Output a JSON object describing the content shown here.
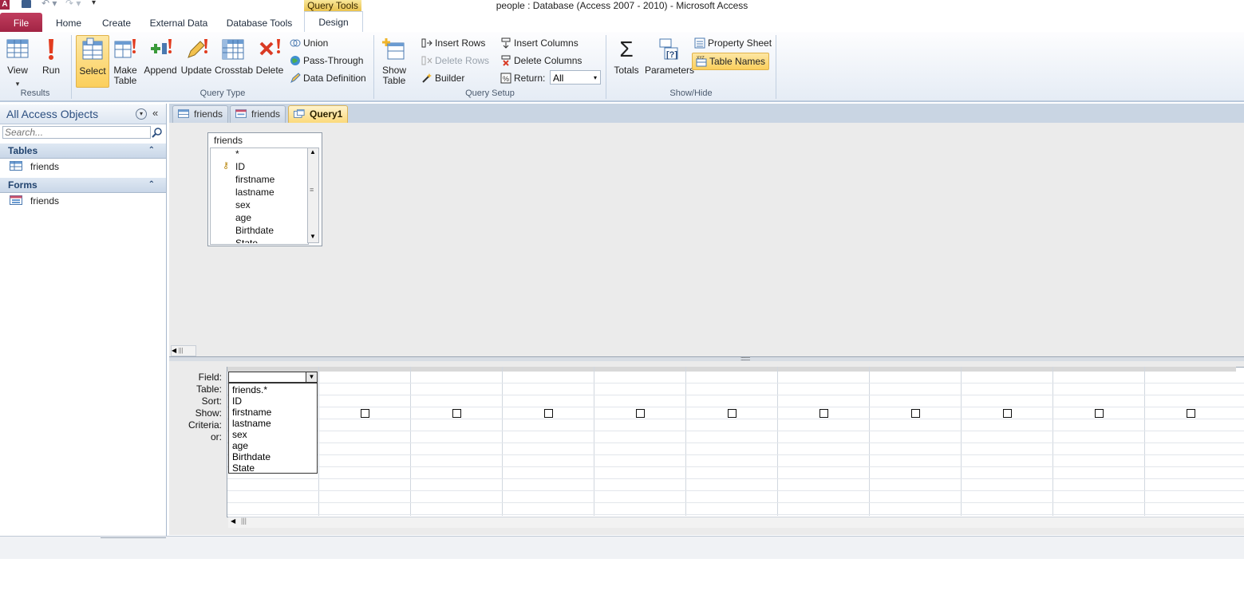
{
  "window": {
    "title": "people : Database (Access 2007 - 2010)  -  Microsoft Access",
    "contextual_tab_group": "Query Tools"
  },
  "ribbon_tabs": [
    "File",
    "Home",
    "Create",
    "External Data",
    "Database Tools",
    "Design"
  ],
  "ribbon": {
    "results": {
      "label": "Results",
      "view": "View",
      "run": "Run"
    },
    "query_type": {
      "label": "Query Type",
      "select": "Select",
      "make_table_1": "Make",
      "make_table_2": "Table",
      "append": "Append",
      "update": "Update",
      "crosstab": "Crosstab",
      "delete": "Delete",
      "union": "Union",
      "pass_through": "Pass-Through",
      "data_definition": "Data Definition"
    },
    "query_setup": {
      "label": "Query Setup",
      "show_table_1": "Show",
      "show_table_2": "Table",
      "insert_rows": "Insert Rows",
      "delete_rows": "Delete Rows",
      "builder": "Builder",
      "insert_columns": "Insert Columns",
      "delete_columns": "Delete Columns",
      "return_label": "Return:",
      "return_value": "All"
    },
    "show_hide": {
      "label": "Show/Hide",
      "totals": "Totals",
      "parameters": "Parameters",
      "property_sheet": "Property Sheet",
      "table_names": "Table Names"
    }
  },
  "nav": {
    "title": "All Access Objects",
    "search_placeholder": "Search...",
    "sections": [
      {
        "name": "Tables",
        "items": [
          "friends"
        ]
      },
      {
        "name": "Forms",
        "items": [
          "friends"
        ]
      }
    ]
  },
  "doc_tabs": [
    "friends",
    "friends",
    "Query1"
  ],
  "field_list": {
    "title": "friends",
    "fields": [
      "*",
      "ID",
      "firstname",
      "lastname",
      "sex",
      "age",
      "Birthdate",
      "State"
    ]
  },
  "grid": {
    "row_labels": [
      "Field:",
      "Table:",
      "Sort:",
      "Show:",
      "Criteria:",
      "or:"
    ],
    "dropdown_options": [
      "friends.*",
      "ID",
      "firstname",
      "lastname",
      "sex",
      "age",
      "Birthdate",
      "State"
    ]
  },
  "colors": {
    "file_tab": "#a22444",
    "active_highlight": "#fbcf5c",
    "nav_title": "#2c4f80"
  }
}
